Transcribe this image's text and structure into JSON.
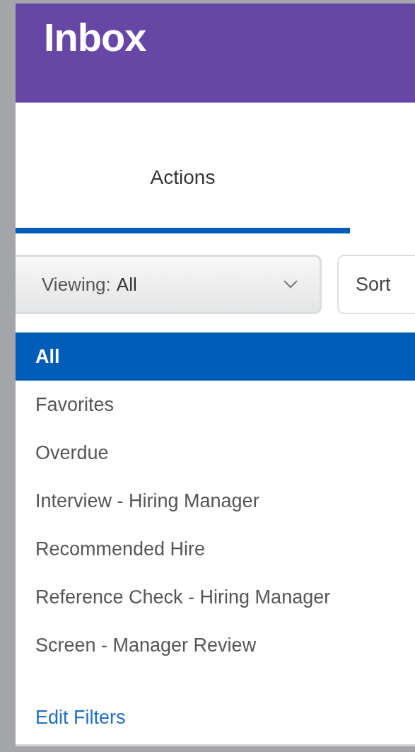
{
  "header": {
    "title": "Inbox"
  },
  "tabs": [
    {
      "label": "Actions",
      "selected": true
    }
  ],
  "viewing_dropdown": {
    "label": "Viewing:",
    "value": "All",
    "expanded": true
  },
  "sort_button": {
    "label": "Sort"
  },
  "filter_menu": {
    "items": [
      {
        "label": "All",
        "selected": true
      },
      {
        "label": "Favorites",
        "selected": false
      },
      {
        "label": "Overdue",
        "selected": false
      },
      {
        "label": "Interview - Hiring Manager",
        "selected": false
      },
      {
        "label": "Recommended Hire",
        "selected": false
      },
      {
        "label": "Reference Check - Hiring Manager",
        "selected": false
      },
      {
        "label": "Screen - Manager Review",
        "selected": false
      }
    ],
    "link": "Edit Filters"
  }
}
